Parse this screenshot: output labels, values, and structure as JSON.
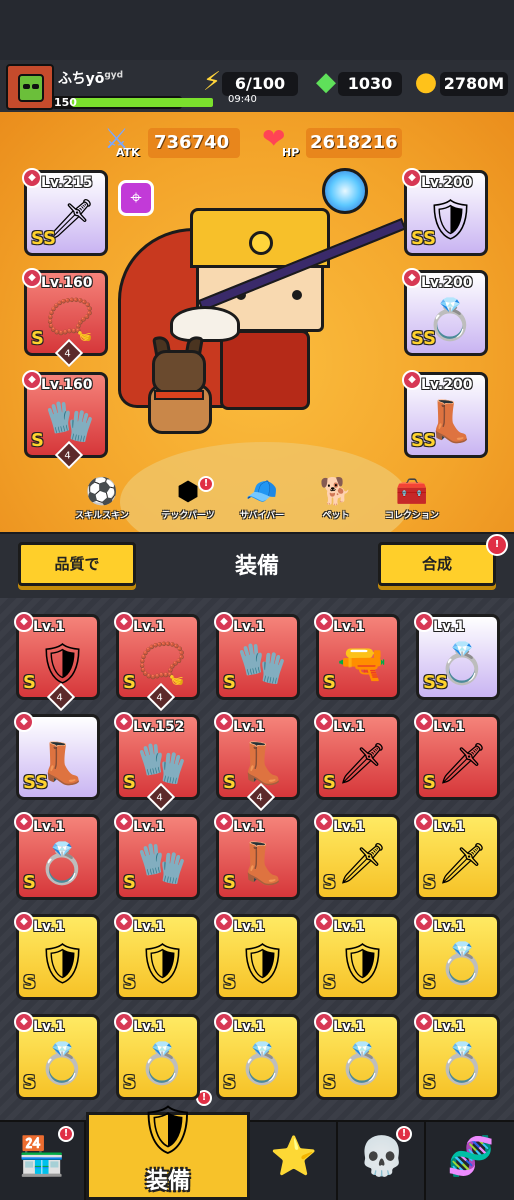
{
  "player": {
    "name": "ふちyō",
    "tag": "gyd",
    "level": "150",
    "level_progress": 0.88
  },
  "resources": {
    "energy": "6/100",
    "energy_timer": "09:40",
    "gems": "1030",
    "coins": "2780M"
  },
  "stats": {
    "atk_label": "ATK",
    "atk_value": "736740",
    "hp_label": "HP",
    "hp_value": "2618216"
  },
  "equipped": {
    "left": [
      {
        "level": "Lv.215",
        "rank": "SS",
        "color": "purple",
        "icon": "staff-icon"
      },
      {
        "level": "Lv.160",
        "rank": "S",
        "color": "red",
        "icon": "necklace-icon",
        "stars": "4"
      },
      {
        "level": "Lv.160",
        "rank": "S",
        "color": "red",
        "icon": "gauntlet-icon",
        "stars": "4"
      }
    ],
    "right": [
      {
        "level": "Lv.200",
        "rank": "SS",
        "color": "purple",
        "icon": "armor-icon"
      },
      {
        "level": "Lv.200",
        "rank": "SS",
        "color": "purple",
        "icon": "ring-icon"
      },
      {
        "level": "Lv.200",
        "rank": "SS",
        "color": "purple",
        "icon": "boots-icon"
      }
    ]
  },
  "menu": [
    {
      "label": "スキルスキン",
      "icon": "soccer-ball-icon"
    },
    {
      "label": "テックパーツ",
      "icon": "hexagon-icon",
      "alert": "!"
    },
    {
      "label": "サバイバー",
      "icon": "survivor-icon"
    },
    {
      "label": "ペット",
      "icon": "dog-icon"
    },
    {
      "label": "コレクション",
      "icon": "chest-icon"
    }
  ],
  "header": {
    "sort_label": "品質で",
    "title": "装備",
    "merge_label": "合成",
    "merge_alert": "!"
  },
  "inventory": [
    {
      "level": "Lv.1",
      "rank": "S",
      "color": "red",
      "icon": "armor-icon",
      "stars": "4"
    },
    {
      "level": "Lv.1",
      "rank": "S",
      "color": "red",
      "icon": "necklace-icon",
      "stars": "4"
    },
    {
      "level": "Lv.1",
      "rank": "S",
      "color": "red",
      "icon": "gauntlet-icon"
    },
    {
      "level": "Lv.1",
      "rank": "S",
      "color": "red",
      "icon": "blaster-icon"
    },
    {
      "level": "Lv.1",
      "rank": "SS",
      "color": "purple",
      "icon": "ring-icon"
    },
    {
      "level": "",
      "rank": "SS",
      "color": "purple",
      "icon": "boots-icon"
    },
    {
      "level": "Lv.152",
      "rank": "S",
      "color": "red",
      "icon": "gauntlet-icon",
      "stars": "4"
    },
    {
      "level": "Lv.1",
      "rank": "S",
      "color": "red",
      "icon": "boots-icon",
      "stars": "4"
    },
    {
      "level": "Lv.1",
      "rank": "S",
      "color": "red",
      "icon": "sword-icon"
    },
    {
      "level": "Lv.1",
      "rank": "S",
      "color": "red",
      "icon": "staff-icon"
    },
    {
      "level": "Lv.1",
      "rank": "S",
      "color": "red",
      "icon": "ring-icon"
    },
    {
      "level": "Lv.1",
      "rank": "S",
      "color": "red",
      "icon": "gauntlet-icon"
    },
    {
      "level": "Lv.1",
      "rank": "S",
      "color": "red",
      "icon": "boots-icon"
    },
    {
      "level": "Lv.1",
      "rank": "S",
      "color": "yellow",
      "icon": "sword-icon"
    },
    {
      "level": "Lv.1",
      "rank": "S",
      "color": "yellow",
      "icon": "sword-icon"
    },
    {
      "level": "Lv.1",
      "rank": "S",
      "color": "yellow",
      "icon": "armor-icon"
    },
    {
      "level": "Lv.1",
      "rank": "S",
      "color": "yellow",
      "icon": "armor-icon"
    },
    {
      "level": "Lv.1",
      "rank": "S",
      "color": "yellow",
      "icon": "armor-icon"
    },
    {
      "level": "Lv.1",
      "rank": "S",
      "color": "yellow",
      "icon": "armor-icon"
    },
    {
      "level": "Lv.1",
      "rank": "S",
      "color": "yellow",
      "icon": "ring-icon"
    },
    {
      "level": "Lv.1",
      "rank": "S",
      "color": "yellow",
      "icon": "ring-icon"
    },
    {
      "level": "Lv.1",
      "rank": "S",
      "color": "yellow",
      "icon": "ring-icon"
    },
    {
      "level": "Lv.1",
      "rank": "S",
      "color": "yellow",
      "icon": "ring-icon"
    },
    {
      "level": "Lv.1",
      "rank": "S",
      "color": "yellow",
      "icon": "ring-icon"
    },
    {
      "level": "Lv.1",
      "rank": "S",
      "color": "yellow",
      "icon": "ring-icon"
    }
  ],
  "nav": {
    "active_label": "装備",
    "shop_alert": "!",
    "equip_alert": "!",
    "skull_alert": "!"
  },
  "colors": {
    "red": "#d6373a",
    "purple": "#c9b4f2",
    "yellow": "#f6c227",
    "hero_bg": "#f3a42a",
    "accent": "#ffcf2a"
  }
}
